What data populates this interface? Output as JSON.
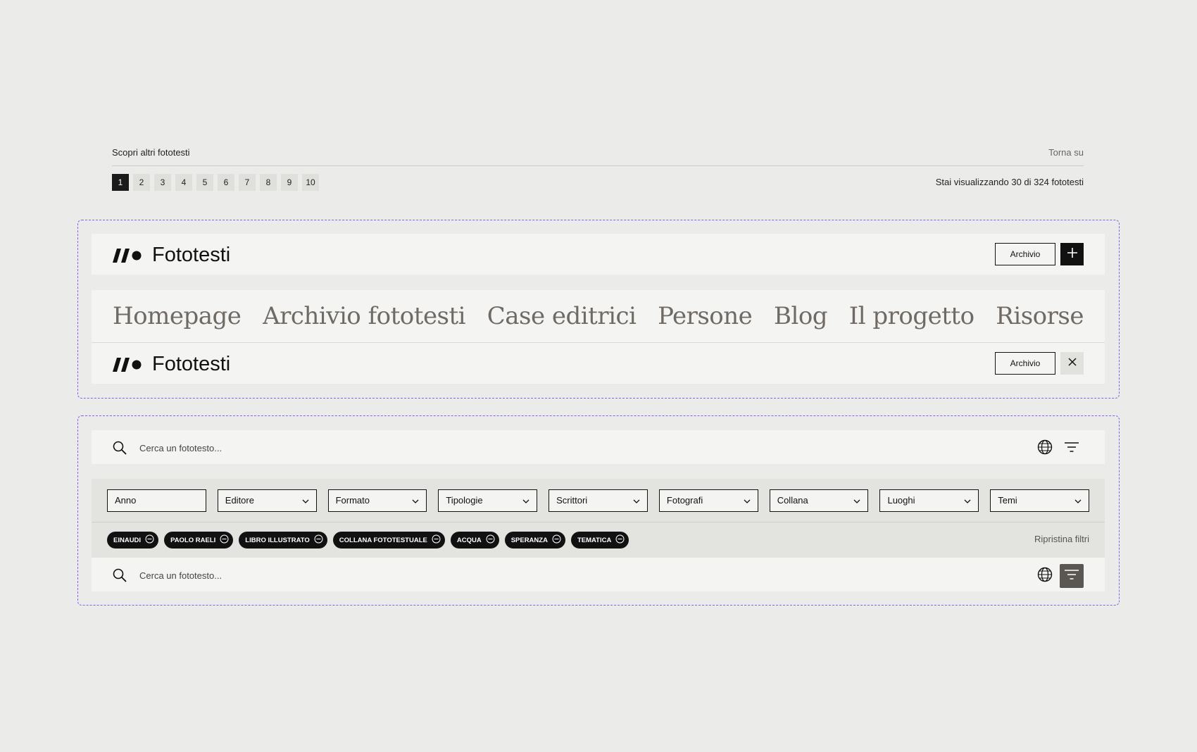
{
  "pagination": {
    "title": "Scopri altri fototesti",
    "back_to_top": "Torna su",
    "pages": [
      "1",
      "2",
      "3",
      "4",
      "5",
      "6",
      "7",
      "8",
      "9",
      "10"
    ],
    "active_page": "1",
    "count_text": "Stai visualizzando 30 di 324 fototesti"
  },
  "header": {
    "brand": "Fototesti",
    "archive_label": "Archivio"
  },
  "menu": {
    "items": [
      "Homepage",
      "Archivio fototesti",
      "Case editrici",
      "Persone",
      "Blog",
      "Il progetto",
      "Risorse"
    ]
  },
  "search": {
    "placeholder": "Cerca un fototesto..."
  },
  "filters": {
    "fields": [
      "Anno",
      "Editore",
      "Formato",
      "Tipologie",
      "Scrittori",
      "Fotografi",
      "Collana",
      "Luoghi",
      "Temi"
    ],
    "chips": [
      "EINAUDI",
      "PAOLO RAELI",
      "LIBRO ILLUSTRATO",
      "COLLANA FOTOTESTUALE",
      "ACQUA",
      "SPERANZA",
      "TEMATICA"
    ],
    "reset_label": "Ripristina filtri"
  },
  "colors": {
    "accent_dash": "#8a5cf0",
    "menu_text": "#6f6a64",
    "dark": "#111111",
    "active_filter_bg": "#5a5753"
  }
}
